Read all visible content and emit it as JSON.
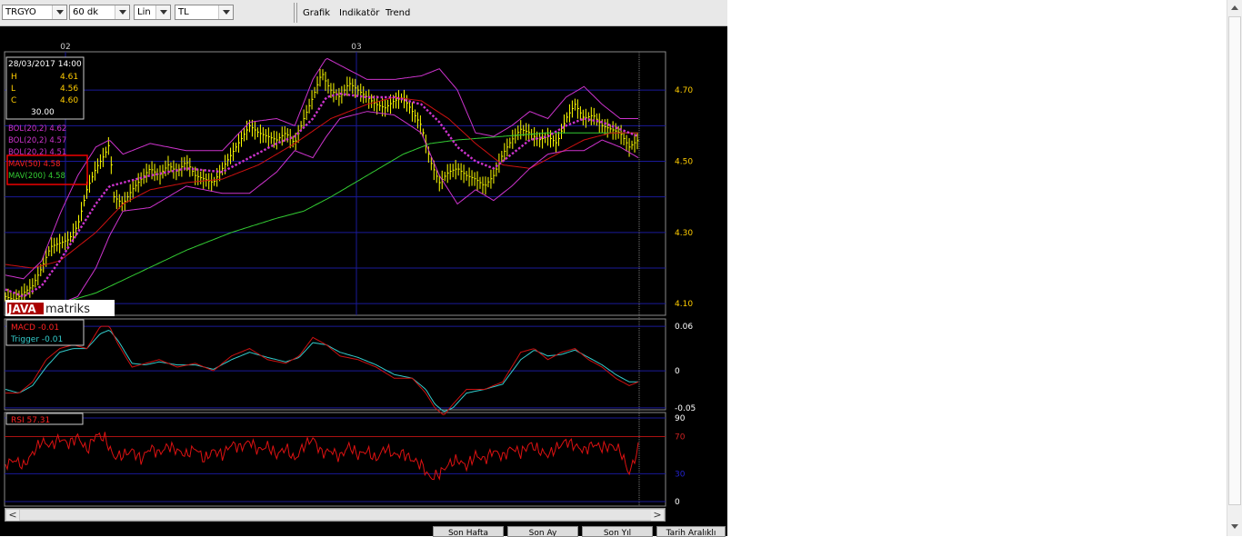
{
  "toolbar": {
    "symbol": "TRGYO",
    "interval": "60 dk",
    "scale": "Lin",
    "currency": "TL",
    "menu": [
      "Grafik",
      "Indikatör",
      "Trend"
    ]
  },
  "colors": {
    "background": "#000000",
    "price_bars": "#ffff00",
    "bollinger": "#cc33cc",
    "mav50": "#cc1111",
    "mav200": "#33cc33",
    "macd": "#cc1111",
    "trigger": "#33cccc",
    "rsi": "#dd1111",
    "grid": "#1a1a99",
    "axis_labels": "#ffcc00"
  },
  "chart_data": [
    {
      "type": "line",
      "panel": "price",
      "x_labels": [
        "02",
        "03"
      ],
      "y_ticks": [
        "4.70",
        "4.50",
        "4.30",
        "4.10"
      ],
      "ylim": [
        4.08,
        4.8
      ],
      "info_box": {
        "datetime": "28/03/2017 14:00",
        "rows": [
          {
            "k": "H",
            "v": "4.61"
          },
          {
            "k": "L",
            "v": "4.56"
          },
          {
            "k": "C",
            "v": "4.60"
          }
        ],
        "volume": "30.00"
      },
      "legend": [
        {
          "label": "BOL(20,2) 4.62",
          "color": "#cc33cc"
        },
        {
          "label": "BOL(20,2) 4.57",
          "color": "#cc33cc"
        },
        {
          "label": "BOL(20,2) 4.51",
          "color": "#cc33cc"
        },
        {
          "label": "MAV(50) 4.58",
          "color": "#ff2222"
        },
        {
          "label": "MAV(200) 4.58",
          "color": "#33cc33"
        }
      ],
      "series": [
        {
          "name": "Close",
          "x": [
            0,
            10,
            20,
            30,
            40,
            50,
            60,
            70,
            80,
            90,
            100,
            110,
            115,
            120,
            130,
            140,
            150,
            160,
            170,
            180,
            190,
            200,
            210,
            220,
            230,
            240,
            250,
            260,
            270,
            280,
            290,
            300,
            310,
            320,
            330,
            340,
            350,
            355,
            360,
            370,
            380,
            390,
            400,
            410,
            420,
            430,
            440,
            450,
            460,
            470,
            480,
            490,
            500,
            510,
            520,
            530,
            540,
            550,
            560,
            570,
            580,
            590,
            600,
            610,
            620,
            630,
            640,
            650,
            660,
            670,
            680,
            690,
            700
          ],
          "values": [
            4.12,
            4.11,
            4.13,
            4.15,
            4.2,
            4.26,
            4.27,
            4.28,
            4.32,
            4.42,
            4.48,
            4.52,
            4.55,
            4.4,
            4.38,
            4.42,
            4.45,
            4.48,
            4.46,
            4.49,
            4.47,
            4.5,
            4.46,
            4.45,
            4.44,
            4.48,
            4.52,
            4.56,
            4.6,
            4.58,
            4.57,
            4.56,
            4.58,
            4.55,
            4.62,
            4.68,
            4.75,
            4.72,
            4.7,
            4.68,
            4.72,
            4.7,
            4.68,
            4.66,
            4.65,
            4.67,
            4.68,
            4.64,
            4.6,
            4.5,
            4.44,
            4.47,
            4.48,
            4.46,
            4.45,
            4.43,
            4.46,
            4.52,
            4.56,
            4.59,
            4.58,
            4.56,
            4.57,
            4.55,
            4.62,
            4.66,
            4.62,
            4.63,
            4.6,
            4.59,
            4.58,
            4.54,
            4.56
          ]
        },
        {
          "name": "BOL(20,2) upper",
          "x": [
            0,
            20,
            40,
            60,
            80,
            100,
            115,
            130,
            160,
            200,
            240,
            270,
            300,
            320,
            340,
            355,
            370,
            400,
            430,
            460,
            480,
            500,
            520,
            540,
            560,
            580,
            600,
            620,
            640,
            660,
            680,
            700
          ],
          "values": [
            4.18,
            4.17,
            4.22,
            4.35,
            4.46,
            4.54,
            4.56,
            4.52,
            4.55,
            4.53,
            4.53,
            4.61,
            4.62,
            4.6,
            4.73,
            4.79,
            4.77,
            4.73,
            4.73,
            4.74,
            4.76,
            4.7,
            4.58,
            4.57,
            4.6,
            4.64,
            4.62,
            4.68,
            4.71,
            4.66,
            4.62,
            4.62
          ]
        },
        {
          "name": "BOL(20,2) middle",
          "x": [
            0,
            20,
            40,
            60,
            80,
            100,
            115,
            130,
            160,
            200,
            240,
            270,
            300,
            320,
            340,
            355,
            370,
            400,
            430,
            460,
            480,
            500,
            520,
            540,
            560,
            580,
            600,
            620,
            640,
            660,
            680,
            700
          ],
          "values": [
            4.14,
            4.12,
            4.15,
            4.22,
            4.3,
            4.38,
            4.43,
            4.44,
            4.46,
            4.48,
            4.47,
            4.51,
            4.55,
            4.57,
            4.62,
            4.68,
            4.69,
            4.68,
            4.68,
            4.66,
            4.61,
            4.54,
            4.5,
            4.48,
            4.52,
            4.56,
            4.57,
            4.6,
            4.62,
            4.61,
            4.59,
            4.57
          ]
        },
        {
          "name": "BOL(20,2) lower",
          "x": [
            0,
            20,
            40,
            60,
            80,
            100,
            115,
            130,
            160,
            200,
            240,
            270,
            300,
            320,
            340,
            355,
            370,
            400,
            430,
            460,
            480,
            500,
            520,
            540,
            560,
            580,
            600,
            620,
            640,
            660,
            680,
            700
          ],
          "values": [
            4.1,
            4.09,
            4.09,
            4.1,
            4.12,
            4.2,
            4.29,
            4.36,
            4.37,
            4.43,
            4.41,
            4.41,
            4.47,
            4.53,
            4.51,
            4.57,
            4.62,
            4.64,
            4.63,
            4.58,
            4.46,
            4.38,
            4.42,
            4.39,
            4.43,
            4.48,
            4.52,
            4.53,
            4.53,
            4.56,
            4.54,
            4.51
          ]
        },
        {
          "name": "MAV(50)",
          "x": [
            0,
            30,
            60,
            100,
            130,
            160,
            200,
            240,
            280,
            320,
            360,
            400,
            430,
            460,
            490,
            520,
            550,
            580,
            610,
            640,
            670,
            700
          ],
          "values": [
            4.21,
            4.2,
            4.22,
            4.3,
            4.38,
            4.42,
            4.44,
            4.45,
            4.49,
            4.55,
            4.62,
            4.66,
            4.68,
            4.67,
            4.62,
            4.55,
            4.49,
            4.48,
            4.52,
            4.56,
            4.58,
            4.58
          ]
        },
        {
          "name": "MAV(200)",
          "x": [
            60,
            100,
            150,
            200,
            250,
            300,
            330,
            360,
            400,
            440,
            470,
            500,
            550,
            600,
            650,
            700
          ],
          "values": [
            4.1,
            4.13,
            4.19,
            4.25,
            4.3,
            4.34,
            4.36,
            4.4,
            4.46,
            4.52,
            4.55,
            4.56,
            4.57,
            4.58,
            4.58,
            4.58
          ]
        }
      ]
    },
    {
      "type": "line",
      "panel": "macd",
      "y_ticks": [
        "0.06",
        "0",
        "-0.05"
      ],
      "ylim": [
        -0.055,
        0.065
      ],
      "legend": [
        {
          "label": "MACD -0.01",
          "color": "#ff2222"
        },
        {
          "label": "Trigger -0.01",
          "color": "#33cccc"
        }
      ],
      "series": [
        {
          "name": "MACD",
          "x": [
            0,
            15,
            30,
            45,
            60,
            75,
            90,
            105,
            115,
            125,
            140,
            155,
            170,
            190,
            210,
            230,
            250,
            270,
            290,
            310,
            325,
            340,
            355,
            370,
            390,
            410,
            430,
            450,
            465,
            475,
            485,
            495,
            510,
            530,
            550,
            570,
            585,
            600,
            615,
            630,
            645,
            660,
            675,
            690,
            700
          ],
          "values": [
            -0.03,
            -0.03,
            -0.015,
            0.015,
            0.03,
            0.035,
            0.03,
            0.06,
            0.06,
            0.035,
            0.005,
            0.01,
            0.015,
            0.005,
            0.01,
            0.0,
            0.02,
            0.03,
            0.015,
            0.01,
            0.02,
            0.045,
            0.035,
            0.02,
            0.015,
            0.005,
            -0.01,
            -0.01,
            -0.03,
            -0.05,
            -0.06,
            -0.045,
            -0.025,
            -0.025,
            -0.015,
            0.025,
            0.03,
            0.015,
            0.025,
            0.03,
            0.015,
            0.005,
            -0.01,
            -0.02,
            -0.015
          ]
        },
        {
          "name": "Trigger",
          "x": [
            0,
            15,
            30,
            45,
            60,
            75,
            90,
            105,
            115,
            125,
            140,
            155,
            170,
            190,
            210,
            230,
            250,
            270,
            290,
            310,
            325,
            340,
            355,
            370,
            390,
            410,
            430,
            450,
            465,
            475,
            485,
            495,
            510,
            530,
            550,
            570,
            585,
            600,
            615,
            630,
            645,
            660,
            675,
            690,
            700
          ],
          "values": [
            -0.025,
            -0.03,
            -0.02,
            0.005,
            0.025,
            0.03,
            0.03,
            0.05,
            0.055,
            0.04,
            0.01,
            0.008,
            0.012,
            0.008,
            0.008,
            0.002,
            0.015,
            0.025,
            0.018,
            0.012,
            0.018,
            0.038,
            0.035,
            0.025,
            0.018,
            0.008,
            -0.005,
            -0.01,
            -0.025,
            -0.045,
            -0.055,
            -0.05,
            -0.03,
            -0.025,
            -0.018,
            0.015,
            0.028,
            0.02,
            0.022,
            0.028,
            0.018,
            0.008,
            -0.005,
            -0.015,
            -0.015
          ]
        }
      ]
    },
    {
      "type": "line",
      "panel": "rsi",
      "y_ticks": [
        "90",
        "70",
        "30",
        "0"
      ],
      "ylim": [
        0,
        90
      ],
      "legend": [
        {
          "label": "RSI 57.31",
          "color": "#ff2222"
        }
      ],
      "series": [
        {
          "name": "RSI",
          "x": [
            0,
            10,
            20,
            30,
            40,
            50,
            60,
            70,
            80,
            90,
            100,
            110,
            120,
            130,
            140,
            150,
            160,
            170,
            180,
            190,
            200,
            210,
            220,
            230,
            240,
            250,
            260,
            270,
            280,
            290,
            300,
            310,
            320,
            330,
            340,
            350,
            360,
            370,
            380,
            390,
            400,
            410,
            420,
            430,
            440,
            450,
            460,
            470,
            480,
            490,
            500,
            510,
            520,
            530,
            540,
            550,
            560,
            570,
            580,
            590,
            600,
            610,
            620,
            630,
            640,
            650,
            660,
            670,
            680,
            690,
            700
          ],
          "values": [
            40,
            45,
            38,
            52,
            65,
            60,
            68,
            62,
            70,
            55,
            72,
            68,
            48,
            50,
            55,
            45,
            58,
            52,
            60,
            55,
            50,
            58,
            45,
            55,
            50,
            62,
            58,
            65,
            55,
            60,
            50,
            58,
            45,
            60,
            68,
            52,
            55,
            48,
            60,
            50,
            55,
            45,
            58,
            50,
            52,
            45,
            40,
            25,
            30,
            40,
            45,
            38,
            50,
            45,
            55,
            48,
            58,
            52,
            62,
            55,
            50,
            58,
            65,
            60,
            55,
            62,
            58,
            60,
            55,
            30,
            57
          ]
        }
      ]
    }
  ],
  "hscroll": {
    "left": "<",
    "right": ">"
  },
  "bottom_buttons": [
    "Son Hafta",
    "Son Ay",
    "Son Yıl",
    "Tarih Aralıklı"
  ]
}
